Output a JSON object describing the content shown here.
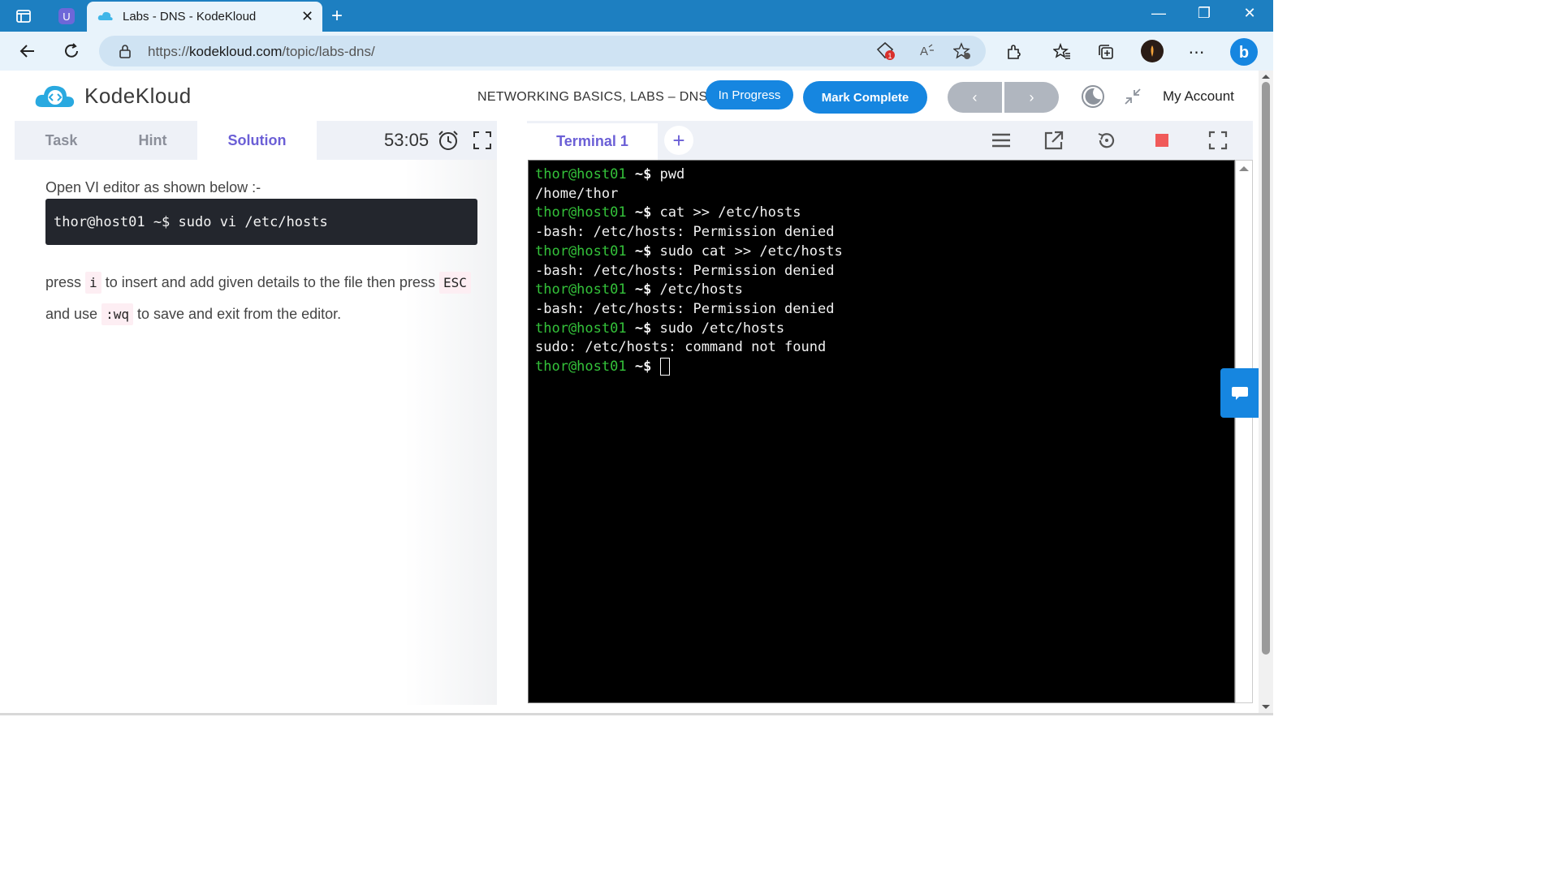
{
  "browser": {
    "tab_title": "Labs - DNS - KodeKloud",
    "url_prefix": "https://",
    "url_domain": "kodekloud.com",
    "url_path": "/topic/labs-dns/",
    "tracker_badge_count": "1",
    "icons": [
      "tab-actions-icon",
      "workspaces-icon",
      "kodekloud-favicon",
      "close-icon",
      "plus-icon",
      "minimize-icon",
      "restore-icon",
      "window-close-icon",
      "back-icon",
      "refresh-icon",
      "lock-icon",
      "tracking-prevention-icon",
      "read-aloud-icon",
      "add-favorite-icon",
      "extensions-icon",
      "favorites-icon",
      "collections-icon",
      "profile-avatar",
      "more-icon",
      "copilot-icon"
    ]
  },
  "header": {
    "logo_text": "KodeKloud",
    "course_title": "NETWORKING BASICS, LABS – DNS",
    "status_badge": "In Progress",
    "mark_complete": "Mark Complete",
    "prev_label": "‹",
    "next_label": "›",
    "account": "My Account"
  },
  "left_panel": {
    "tabs": [
      "Task",
      "Hint",
      "Solution"
    ],
    "active_tab": "Solution",
    "timer": "53:05",
    "instruction": "Open VI editor as shown below :-",
    "code": "thor@host01 ~$ sudo vi /etc/hosts",
    "para": {
      "p1": "press",
      "k1": "i",
      "p2": "to insert and add given details to the file then press",
      "k2": "ESC",
      "p3": "and use",
      "k3": ":wq",
      "p4": "to save and exit from the editor."
    }
  },
  "terminal": {
    "tab_label": "Terminal 1",
    "add_label": "+",
    "prompt_user": "thor@host01",
    "prompt_sym": "~$",
    "lines": [
      {
        "cmd": "pwd"
      },
      {
        "out": "/home/thor"
      },
      {
        "cmd": "cat >> /etc/hosts"
      },
      {
        "out": "-bash: /etc/hosts: Permission denied"
      },
      {
        "cmd": "sudo cat >> /etc/hosts"
      },
      {
        "out": "-bash: /etc/hosts: Permission denied"
      },
      {
        "cmd": "/etc/hosts"
      },
      {
        "out": "-bash: /etc/hosts: Permission denied"
      },
      {
        "cmd": "sudo /etc/hosts"
      },
      {
        "out": "sudo: /etc/hosts: command not found"
      },
      {
        "cmd": ""
      }
    ]
  },
  "colors": {
    "brand_blue": "#1686e0",
    "accent_purple": "#6b5fd6",
    "prompt_green": "#34c23a",
    "stop_red": "#f05a5a"
  }
}
